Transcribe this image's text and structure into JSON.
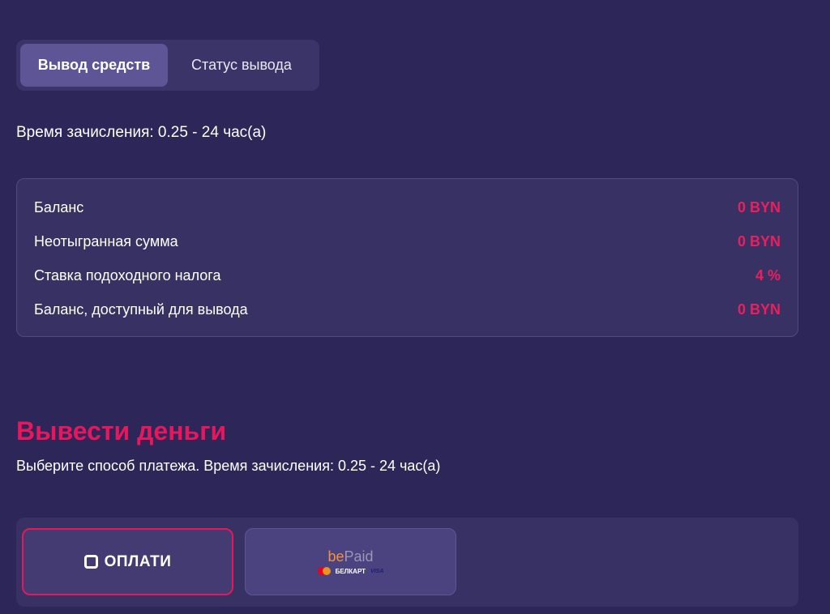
{
  "tabs": {
    "withdraw": "Вывод средств",
    "status": "Статус вывода"
  },
  "credit_time": "Время зачисления: 0.25 - 24 час(а)",
  "balance": {
    "rows": [
      {
        "label": "Баланс",
        "value": "0 BYN"
      },
      {
        "label": "Неотыгранная сумма",
        "value": "0 BYN"
      },
      {
        "label": "Ставка подоходного налога",
        "value": "4 %"
      },
      {
        "label": "Баланс, доступный для вывода",
        "value": "0 BYN"
      }
    ]
  },
  "withdraw_section": {
    "title": "Вывести деньги",
    "subtitle": "Выберите способ платежа. Время зачисления: 0.25 - 24 час(а)"
  },
  "methods": {
    "oplati": {
      "label": "ОПЛАТИ",
      "icon": "oplati-logo-icon"
    },
    "bepaid": {
      "be": "be",
      "paid": "Paid",
      "belkart": "БЕЛКАРТ",
      "visa": "VISA"
    }
  },
  "colors": {
    "background": "#2d2659",
    "accent": "#e8165d",
    "card": "#383163"
  }
}
